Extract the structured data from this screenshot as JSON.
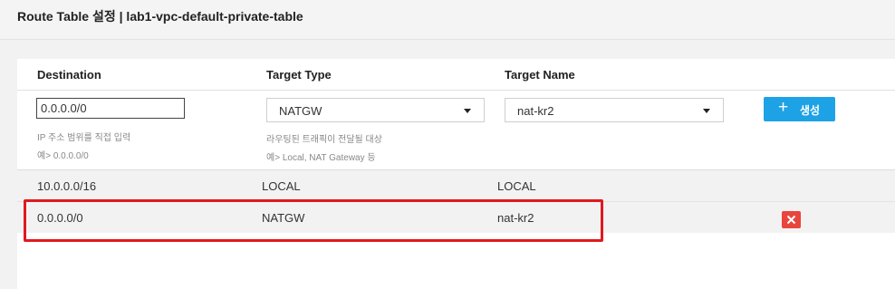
{
  "header": {
    "title": "Route Table 설정 | lab1-vpc-default-private-table"
  },
  "columns": {
    "destination": "Destination",
    "target_type": "Target Type",
    "target_name": "Target Name"
  },
  "form": {
    "destination_value": "0.0.0.0/0",
    "destination_help_1": "IP 주소 범위를 직접 입력",
    "destination_help_2": "예> 0.0.0.0/0",
    "target_type_value": "NATGW",
    "target_type_help_1": "라우팅된 트래픽이 전달될 대상",
    "target_type_help_2": "예> Local, NAT Gateway 등",
    "target_name_value": "nat-kr2",
    "create_button_label": "생성",
    "create_button_icon": "+"
  },
  "rows": [
    {
      "destination": "10.0.0.0/16",
      "target_type": "LOCAL",
      "target_name": "LOCAL"
    },
    {
      "destination": "0.0.0.0/0",
      "target_type": "NATGW",
      "target_name": "nat-kr2",
      "deletable": true
    }
  ],
  "colors": {
    "accent": "#1ea2e6",
    "delete": "#e8453c",
    "highlight": "#e0191e"
  }
}
